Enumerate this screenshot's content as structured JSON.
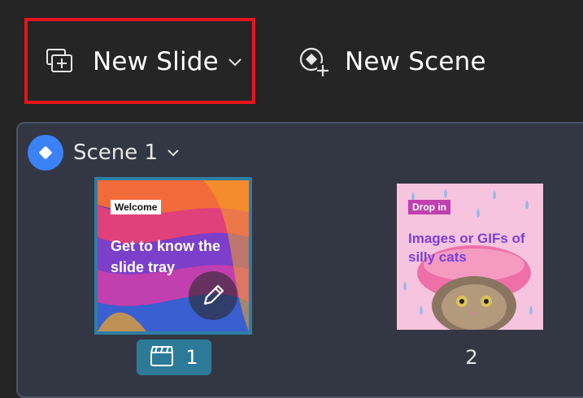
{
  "toolbar": {
    "new_slide_label": "New Slide",
    "new_scene_label": "New Scene",
    "highlight_color": "#e8141c",
    "new_slide_icon": "add-slide-icon",
    "new_scene_icon": "add-scene-icon"
  },
  "scene": {
    "title": "Scene 1",
    "badge_color": "#3b82f6",
    "icon": "diamond-icon"
  },
  "slides": [
    {
      "number": "1",
      "tag": "Welcome",
      "text": "Get to know the slide tray",
      "selected": true,
      "icon": "clapperboard-icon",
      "edit_icon": "pencil-icon"
    },
    {
      "number": "2",
      "tag": "Drop in",
      "text": "Images or GIFs of silly cats",
      "selected": false
    }
  ]
}
